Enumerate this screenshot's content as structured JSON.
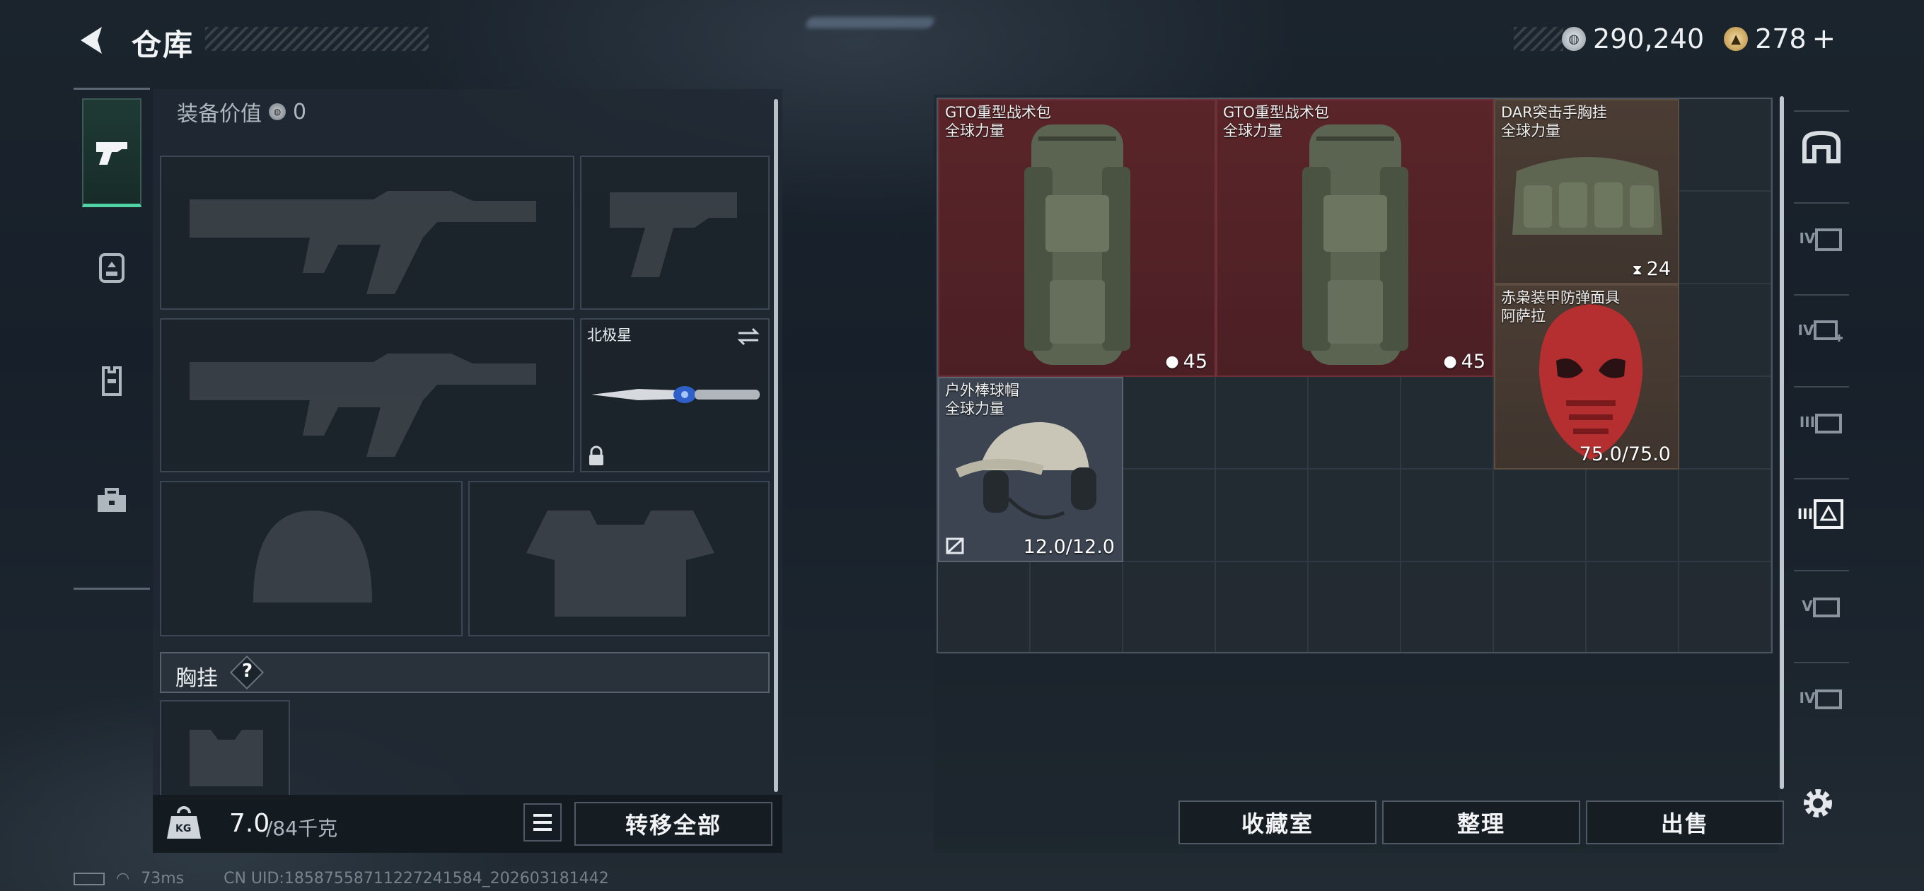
{
  "header": {
    "title": "仓库",
    "currency_primary": "290,240",
    "currency_secondary": "278",
    "currency_secondary_add": "+"
  },
  "loadout": {
    "value_label": "装备价值",
    "value": "0",
    "melee_name": "北极星",
    "chest_rig_label": "胸挂",
    "chest_rig_help": "?",
    "weight_current": "7.0",
    "weight_max": "/84千克",
    "weight_icon_text": "KG",
    "transfer_all": "转移全部"
  },
  "stash_items": [
    {
      "name": "GTO重型战术包",
      "tag": "全球力量",
      "value": "45"
    },
    {
      "name": "GTO重型战术包",
      "tag": "全球力量",
      "value": "45"
    },
    {
      "name": "DAR突击手胸挂",
      "tag": "全球力量",
      "value": "24"
    },
    {
      "name": "赤枭装甲防弹面具",
      "tag": "阿萨拉",
      "value": "75.0/75.0"
    },
    {
      "name": "户外棒球帽",
      "tag": "全球力量",
      "value": "12.0/12.0"
    }
  ],
  "side_categories": [
    "stash-main",
    "IV",
    "IV+",
    "III",
    "III",
    "V",
    "IV"
  ],
  "actions": {
    "collection": "收藏室",
    "organize": "整理",
    "sell": "出售"
  },
  "status_bar": {
    "ping": "73ms",
    "uid": "CN UID:18587558711227241584_202603181442"
  },
  "colors": {
    "accent": "#4fd3a4",
    "rare_red": "#5a2529",
    "rare_brown": "#4b3d34"
  }
}
